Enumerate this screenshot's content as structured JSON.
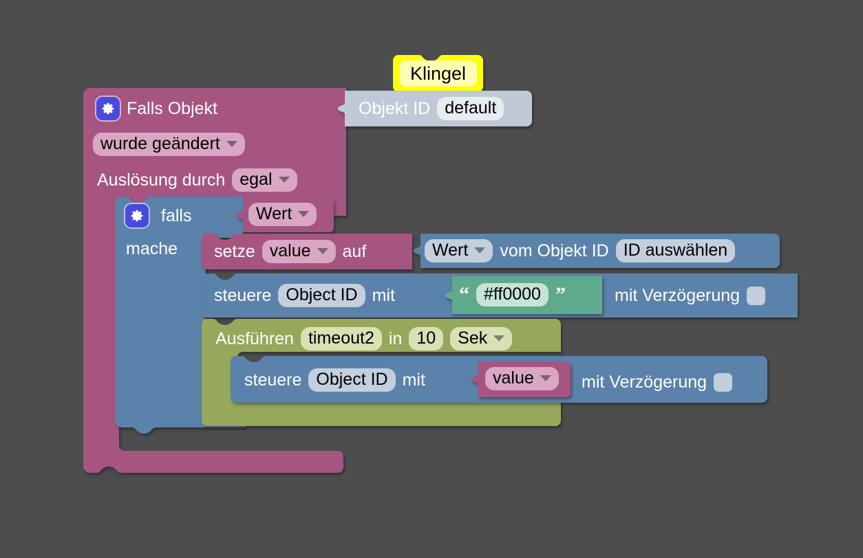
{
  "workspace": {
    "background_color": "#4d4d4d",
    "language": "de"
  },
  "tag": {
    "label": "Klingel",
    "color": "#ffff00",
    "field_color": "#ffffb4"
  },
  "trigger_block": {
    "name": "on-object-change-trigger",
    "color": "#a55580",
    "icon": "gear-icon",
    "title": "Falls Objekt",
    "object_id_block": {
      "label": "Objekt ID",
      "value": "default",
      "color": "#bfcad6"
    },
    "condition_dropdown": "wurde geändert",
    "source_label": "Auslösung durch",
    "source_dropdown": "egal"
  },
  "if_block": {
    "name": "if-block",
    "color": "#5b82ab",
    "icon": "gear-icon",
    "if_label": "falls",
    "do_label": "mache",
    "condition_value": "Wert"
  },
  "set_block": {
    "name": "set-variable-block",
    "color": "#a55580",
    "set_label": "setze",
    "variable": "value",
    "to_label": "auf",
    "value_block": {
      "color": "#5b82ab",
      "property_dropdown": "Wert",
      "from_label": "vom Objekt ID",
      "object_id": "ID auswählen"
    }
  },
  "control_block_1": {
    "name": "control-block",
    "color": "#5b82ab",
    "control_label": "steuere",
    "object_id": "Object ID",
    "with_label": "mit",
    "string_value": {
      "color": "#5faa8c",
      "text": "#ff0000",
      "open_quote": "“",
      "close_quote": "”"
    },
    "delay_label": "mit Verzögerung",
    "delay_value": ""
  },
  "timeout_block": {
    "name": "timeout-block",
    "color": "#95a85c",
    "run_label": "Ausführen",
    "timer_name": "timeout2",
    "in_label": "in",
    "duration": "10",
    "unit": "Sek"
  },
  "control_block_2": {
    "name": "control-block-inner",
    "color": "#5b82ab",
    "control_label": "steuere",
    "object_id": "Object ID",
    "with_label": "mit",
    "variable_value": {
      "color": "#a55580",
      "variable": "value"
    },
    "delay_label": "mit Verzögerung",
    "delay_value": ""
  }
}
